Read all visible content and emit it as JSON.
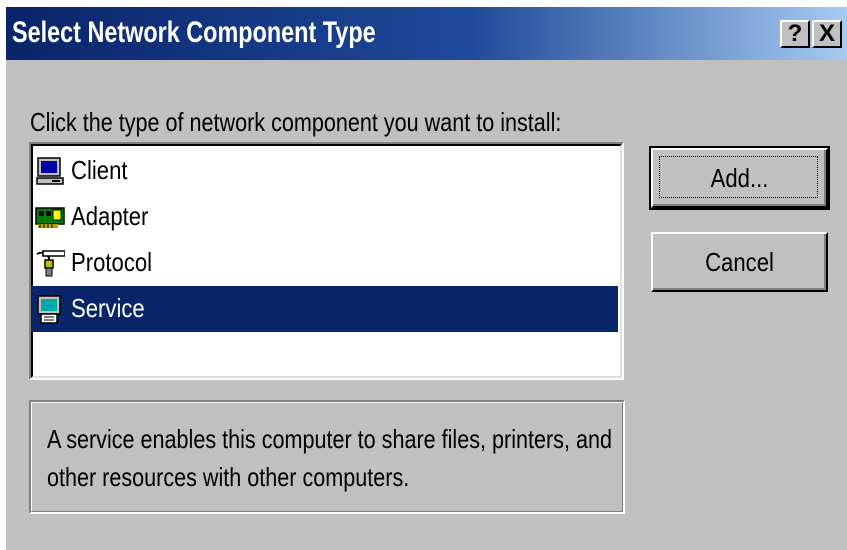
{
  "dialog": {
    "title": "Select Network Component Type",
    "help_button": "?",
    "close_button": "X",
    "prompt": "Click the type of network component you want to install:",
    "components": [
      {
        "label": "Client",
        "icon": "client-computer-icon",
        "selected": false
      },
      {
        "label": "Adapter",
        "icon": "network-adapter-icon",
        "selected": false
      },
      {
        "label": "Protocol",
        "icon": "protocol-cable-icon",
        "selected": false
      },
      {
        "label": "Service",
        "icon": "service-computer-icon",
        "selected": true
      }
    ],
    "add_button": "Add...",
    "cancel_button": "Cancel",
    "description": "A service enables this computer to share files, printers, and other resources with other computers."
  },
  "colors": {
    "title_bar_start": "#0a246a",
    "title_bar_end": "#a6caf0",
    "face": "#c0c0c0",
    "selection": "#0a246a"
  }
}
